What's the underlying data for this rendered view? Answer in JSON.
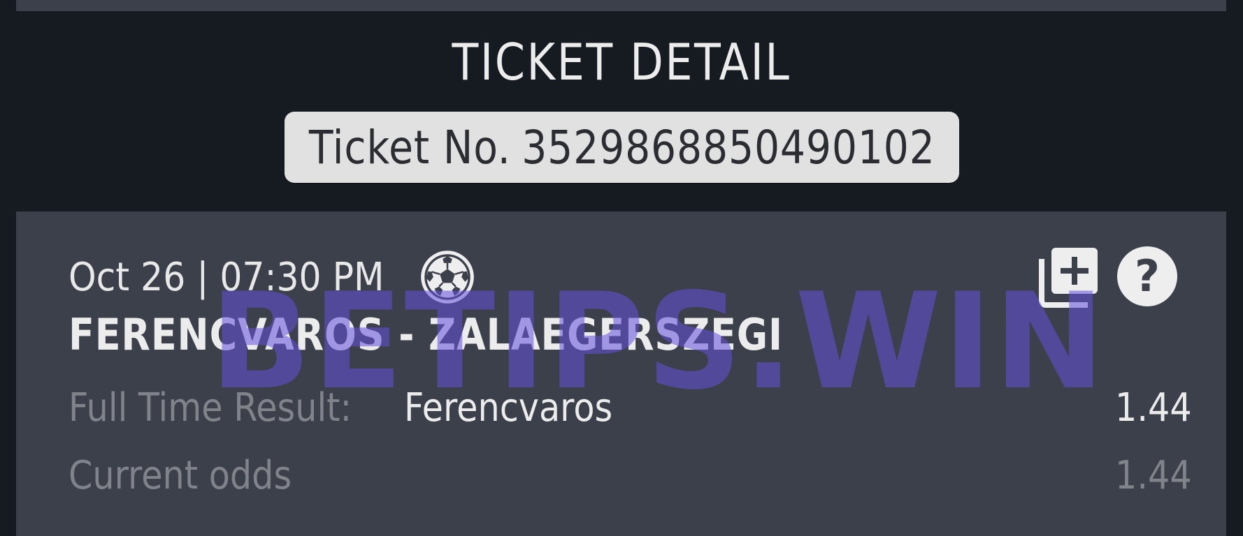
{
  "header": {
    "title": "TICKET DETAIL",
    "ticket_label": "Ticket No.",
    "ticket_number": "3529868850490102"
  },
  "bet": {
    "date": "Oct 26",
    "separator": "|",
    "time": "07:30 PM",
    "sport_icon": "soccer-ball-icon",
    "match": "FERENCVAROS - ZALAEGERSZEGI",
    "market_label": "Full Time Result:",
    "selection": "Ferencvaros",
    "odds": "1.44",
    "current_odds_label": "Current odds",
    "current_odds": "1.44"
  },
  "actions": {
    "add_icon": "library-add-icon",
    "help_icon": "help-circle-icon"
  },
  "watermark": "BETIPS.WIN",
  "colors": {
    "background": "#161a21",
    "card": "#3c404a",
    "text_primary": "#ececec",
    "text_muted": "#80838a",
    "pill": "#e1e1e1",
    "watermark": "#6450dc"
  }
}
